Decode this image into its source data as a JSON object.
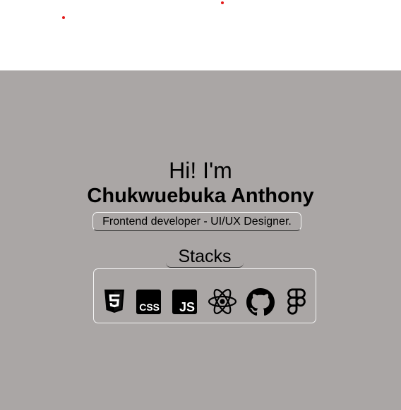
{
  "colors": {
    "page_background": "#ffffff",
    "hero_background": "#aaa6a5",
    "dot_color": "#e31b1b",
    "text": "#000000"
  },
  "hero": {
    "greeting": "Hi! I'm",
    "name": "Chukwuebuka Anthony",
    "role": "Frontend developer - UI/UX Designer."
  },
  "stacks": {
    "title": "Stacks",
    "icons": [
      "html5-icon",
      "css-icon",
      "javascript-icon",
      "react-icon",
      "github-icon",
      "figma-icon"
    ],
    "css_label": "CSS",
    "js_label": "JS"
  }
}
